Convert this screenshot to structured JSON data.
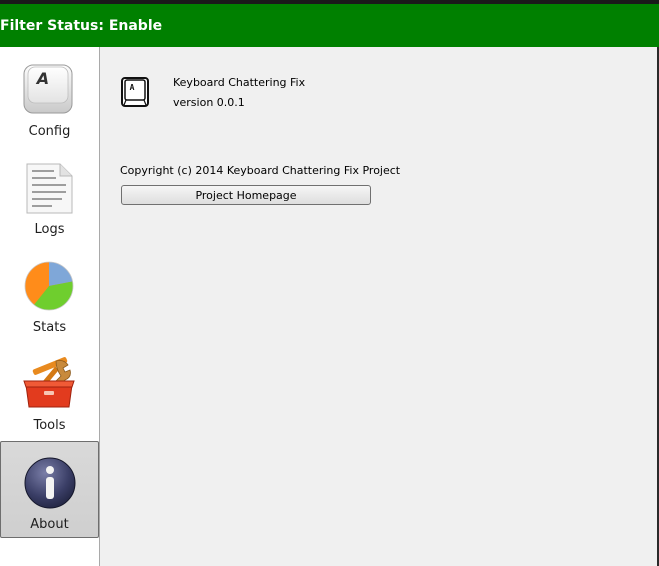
{
  "status_bar": {
    "text": "Filter Status: Enable",
    "color": "#008000"
  },
  "sidebar": {
    "items": [
      {
        "label": "Config",
        "icon": "keyboard-key-icon",
        "active": false
      },
      {
        "label": "Logs",
        "icon": "document-icon",
        "active": false
      },
      {
        "label": "Stats",
        "icon": "pie-chart-icon",
        "active": false
      },
      {
        "label": "Tools",
        "icon": "toolbox-icon",
        "active": false
      },
      {
        "label": "About",
        "icon": "info-icon",
        "active": true
      }
    ]
  },
  "about": {
    "app_name": "Keyboard Chattering Fix",
    "version": "version 0.0.1",
    "copyright": "Copyright (c) 2014 Keyboard Chattering Fix Project",
    "homepage_button": "Project Homepage",
    "app_icon": "keyboard-key-icon"
  }
}
